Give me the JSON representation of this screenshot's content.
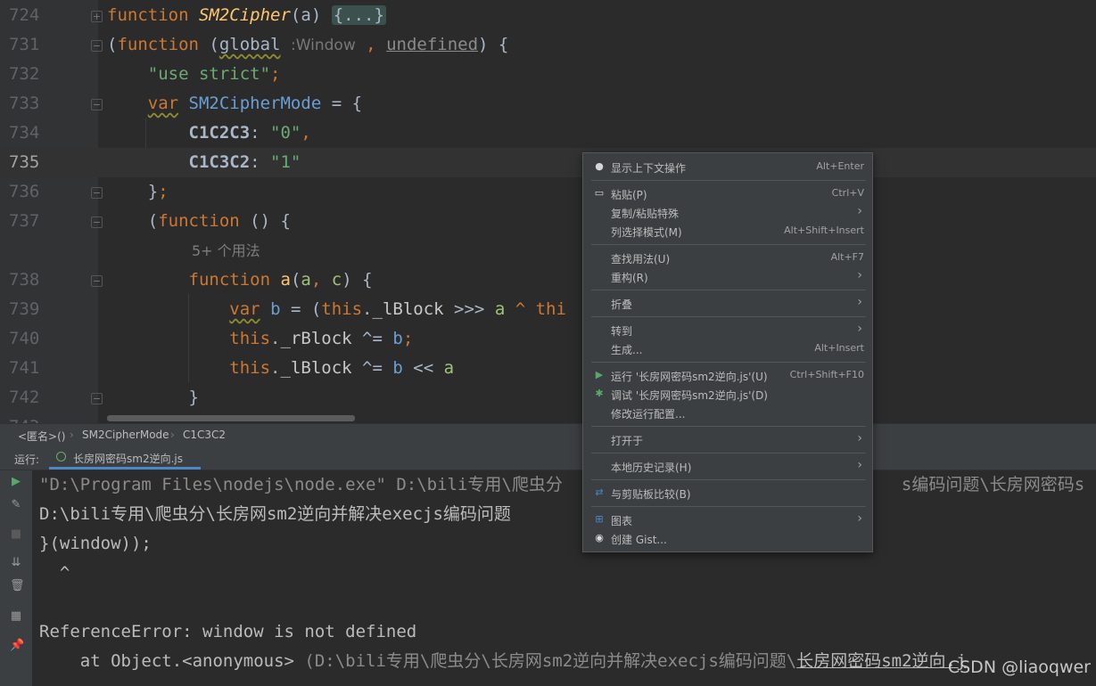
{
  "editor": {
    "lines": [
      {
        "num": "724"
      },
      {
        "num": "731"
      },
      {
        "num": "732"
      },
      {
        "num": "733"
      },
      {
        "num": "734"
      },
      {
        "num": "735"
      },
      {
        "num": "736"
      },
      {
        "num": "737"
      },
      {
        "num": "738"
      },
      {
        "num": "739"
      },
      {
        "num": "740"
      },
      {
        "num": "741"
      },
      {
        "num": "742"
      },
      {
        "num": "743"
      }
    ],
    "code": {
      "l724_kw": "function",
      "l724_name": "SM2Cipher",
      "l724_param": "a",
      "l724_fold": "{...}",
      "l731_kw": "function",
      "l731_global": "global",
      "l731_hint": "Window",
      "l731_undef": "undefined",
      "l732_str": "\"use strict\"",
      "l733_kw": "var",
      "l733_name": "SM2CipherMode",
      "l734_key": "C1C2C3",
      "l734_val": "\"0\"",
      "l735_key": "C1C3C2",
      "l735_val": "\"1\"",
      "l737_kw": "function",
      "usage_hint": "5+ 个用法",
      "l738_kw": "function",
      "l738_name": "a",
      "l738_p1": "a",
      "l738_p2": "c",
      "l739_kw": "var",
      "l739_var": "b",
      "l739_this": "this",
      "l739_prop": "_lBlock",
      "l739_rest": ">>>",
      "l739_a": "a",
      "l739_tail": "^ thi",
      "l740_this": "this",
      "l740_prop": "_rBlock",
      "l740_op": "^=",
      "l740_b": "b",
      "l741_this": "this",
      "l741_prop": "_lBlock",
      "l741_op": "^=",
      "l741_b": "b",
      "l741_shift": "<<",
      "l741_a": "a"
    }
  },
  "breadcrumbs": {
    "items": [
      "<匿名>()",
      "SM2CipherMode",
      "C1C3C2"
    ]
  },
  "run": {
    "label": "运行:",
    "tab": "长房网密码sm2逆向.js"
  },
  "console": {
    "line1": "\"D:\\Program Files\\nodejs\\node.exe\" D:\\bili专用\\爬虫分",
    "line1_tail": "s编码问题\\长房网密码s",
    "line2": "D:\\bili专用\\爬虫分\\长房网sm2逆向并解决execjs编码问题",
    "line3": "}(window));",
    "line4": "  ^",
    "line6": "ReferenceError: window is not defined",
    "line7_at": "    at Object.<anonymous>",
    "line7_path": " (D:\\bili专用\\爬虫分\\长房网sm2逆向并解决execjs编码问题\\",
    "line7_tail": "长房网密码sm2逆向.j"
  },
  "context_menu": {
    "items": [
      {
        "label": "显示上下文操作",
        "shortcut": "Alt+Enter",
        "icon": "bulb-icon"
      },
      {
        "label": "粘贴(P)",
        "shortcut": "Ctrl+V",
        "icon": "clipboard-icon"
      },
      {
        "label": "复制/粘贴特殊",
        "shortcut": ""
      },
      {
        "label": "列选择模式(M)",
        "shortcut": "Alt+Shift+Insert"
      },
      {
        "label": "查找用法(U)",
        "shortcut": "Alt+F7"
      },
      {
        "label": "重构(R)",
        "shortcut": ""
      },
      {
        "label": "折叠",
        "shortcut": ""
      },
      {
        "label": "转到",
        "shortcut": ""
      },
      {
        "label": "生成...",
        "shortcut": "Alt+Insert"
      },
      {
        "label": "运行 '长房网密码sm2逆向.js'(U)",
        "shortcut": "Ctrl+Shift+F10",
        "icon": "run-icon"
      },
      {
        "label": "调试 '长房网密码sm2逆向.js'(D)",
        "shortcut": "",
        "icon": "debug-icon"
      },
      {
        "label": "修改运行配置...",
        "shortcut": ""
      },
      {
        "label": "打开于",
        "shortcut": ""
      },
      {
        "label": "本地历史记录(H)",
        "shortcut": ""
      },
      {
        "label": "与剪贴板比较(B)",
        "shortcut": "",
        "icon": "compare-icon"
      },
      {
        "label": "图表",
        "shortcut": "",
        "icon": "diagram-icon"
      },
      {
        "label": "创建 Gist...",
        "shortcut": "",
        "icon": "github-icon"
      }
    ],
    "arrow": "›"
  },
  "watermark": "CSDN @liaoqwer",
  "colors": {
    "editor_bg": "#2b2b2b",
    "keyword": "#cc7832",
    "string": "#6a8759",
    "function_name": "#ffc66d",
    "menu_bg": "#3c3f41"
  }
}
